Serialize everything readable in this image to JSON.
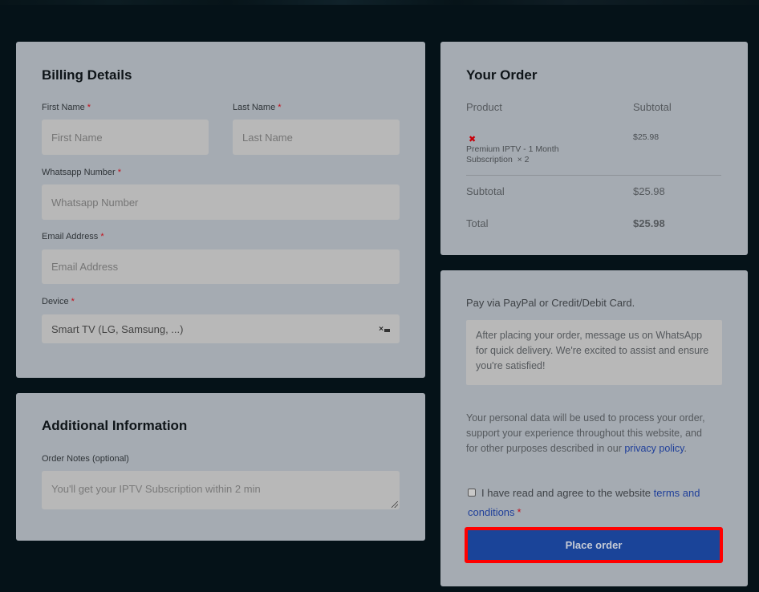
{
  "billing": {
    "title": "Billing Details",
    "first_name": {
      "label": "First Name",
      "required": "*",
      "placeholder": "First Name",
      "value": ""
    },
    "last_name": {
      "label": "Last Name",
      "required": "*",
      "placeholder": "Last Name",
      "value": ""
    },
    "whatsapp": {
      "label": "Whatsapp Number",
      "required": "*",
      "placeholder": "Whatsapp Number",
      "value": ""
    },
    "email": {
      "label": "Email Address",
      "required": "*",
      "placeholder": "Email Address",
      "value": ""
    },
    "device": {
      "label": "Device",
      "required": "*",
      "selected": "Smart TV (LG, Samsung, ...)",
      "clear_icon": "×"
    }
  },
  "additional": {
    "title": "Additional Information",
    "notes": {
      "label": "Order Notes (optional)",
      "placeholder": "You'll get your IPTV Subscription within 2 min",
      "value": ""
    }
  },
  "order": {
    "title": "Your Order",
    "col_product": "Product",
    "col_subtotal": "Subtotal",
    "items": [
      {
        "remove_icon": "✖",
        "name_line1": "Premium IPTV - 1 Month",
        "name_line2": "Subscription",
        "qty": "× 2",
        "subtotal": "$25.98"
      }
    ],
    "subtotal_label": "Subtotal",
    "subtotal_value": "$25.98",
    "total_label": "Total",
    "total_value": "$25.98"
  },
  "payment": {
    "method": "Pay via PayPal or Credit/Debit Card.",
    "description": "After placing your order, message us on WhatsApp for quick delivery. We're excited to assist and ensure you're satisfied!",
    "privacy_text": "Your personal data will be used to process your order, support your experience throughout this website, and for other purposes described in our ",
    "privacy_link": "privacy policy",
    "privacy_end": ".",
    "terms_text": "I have read and agree to the website ",
    "terms_link": "terms and conditions",
    "terms_required": "*",
    "terms_checked": false,
    "place_order": "Place order",
    "accent_color": "#1a4499",
    "highlight_color": "#ff0000"
  }
}
